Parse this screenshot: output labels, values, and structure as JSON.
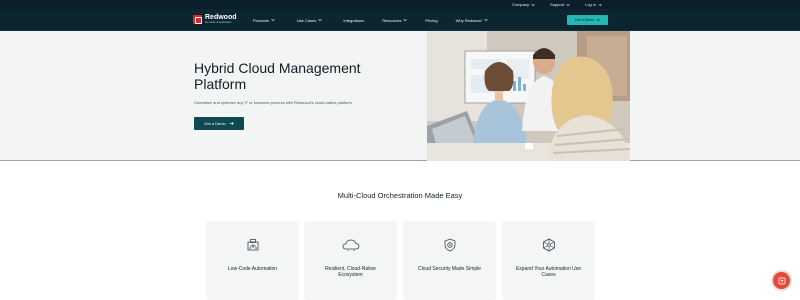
{
  "utility": {
    "company": "Company",
    "support": "Support",
    "login": "Log in"
  },
  "brand": {
    "name": "Redwood",
    "tagline": "the future of automation",
    "accent": "#d62b2b"
  },
  "nav": {
    "items": [
      "Products",
      "Use Cases",
      "Integrations",
      "Resources",
      "Pricing",
      "Why Redwood"
    ],
    "cta": "Get a Demo"
  },
  "hero": {
    "title": "Hybrid Cloud Management Platform",
    "subtitle": "Centralize and optimize any IT or business process with Redwood's cloud-native platform.",
    "button": "Get a Demo"
  },
  "section": {
    "title": "Multi-Cloud Orchestration Made Easy",
    "cards": [
      {
        "title": "Low-Code Automation",
        "icon": "workflow-icon"
      },
      {
        "title": "Resilient, Cloud-Native Ecosystem",
        "icon": "cloud-icon"
      },
      {
        "title": "Cloud Security Made Simple",
        "icon": "shield-icon"
      },
      {
        "title": "Expand Your Automation Use Cases",
        "icon": "network-icon"
      }
    ]
  },
  "colors": {
    "navy": "#0b2631",
    "teal": "#23b8b3",
    "dark_teal": "#0f4a53"
  }
}
